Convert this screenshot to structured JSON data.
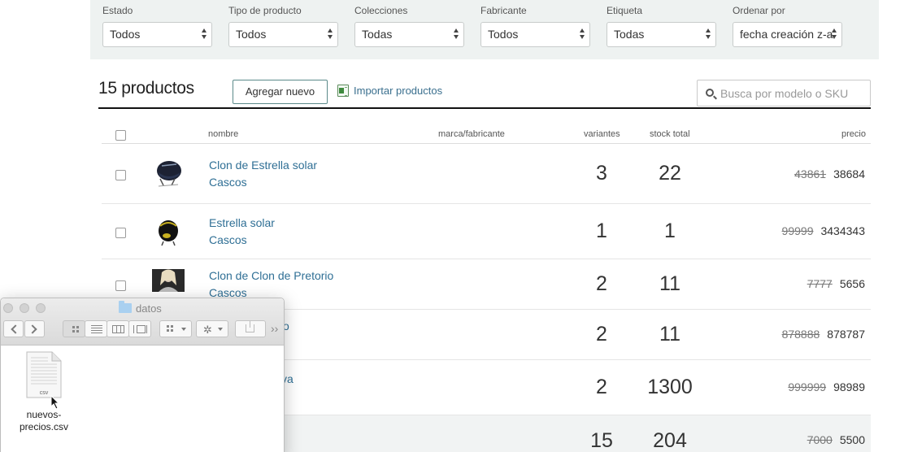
{
  "filters": [
    {
      "label": "Estado",
      "value": "Todos"
    },
    {
      "label": "Tipo de producto",
      "value": "Todos"
    },
    {
      "label": "Colecciones",
      "value": "Todas"
    },
    {
      "label": "Fabricante",
      "value": "Todos"
    },
    {
      "label": "Etiqueta",
      "value": "Todas"
    },
    {
      "label": "Ordenar por",
      "value": "fecha creación z-a"
    }
  ],
  "header": {
    "title": "15 productos",
    "add_button": "Agregar nuevo",
    "import_link": "Importar productos",
    "search_placeholder": "Busca por modelo o SKU"
  },
  "table": {
    "columns": {
      "name": "nombre",
      "brand": "marca/fabricante",
      "variants": "variantes",
      "stock": "stock total",
      "price": "precio"
    },
    "rows": [
      {
        "name": "Clon de Estrella solar",
        "category": "Cascos",
        "variants": "3",
        "stock": "22",
        "old_price": "43861",
        "price": "38684",
        "thumb": "helmet-dark"
      },
      {
        "name": "Estrella solar",
        "category": "Cascos",
        "variants": "1",
        "stock": "1",
        "old_price": "99999",
        "price": "3434343",
        "thumb": "helmet-black"
      },
      {
        "name": "Clon de Clon de Pretorio",
        "category": "Cascos",
        "variants": "2",
        "stock": "11",
        "old_price": "7777",
        "price": "5656",
        "thumb": "photo-person"
      },
      {
        "name": "o",
        "category": "",
        "variants": "2",
        "stock": "11",
        "old_price": "878888",
        "price": "878787",
        "thumb": ""
      },
      {
        "name": "va",
        "category": "",
        "variants": "2",
        "stock": "1300",
        "old_price": "999999",
        "price": "98989",
        "thumb": ""
      },
      {
        "name": "",
        "category": "",
        "variants": "15",
        "stock": "204",
        "old_price": "7000",
        "price": "5500",
        "thumb": ""
      }
    ]
  },
  "finder": {
    "title": "datos",
    "more": "››",
    "file": {
      "name": "nuevos-precios.csv",
      "type": "csv"
    }
  },
  "colors": {
    "link": "#2f6f95",
    "filter_bg": "#eef2f1",
    "button_border": "#5b8a8a"
  }
}
